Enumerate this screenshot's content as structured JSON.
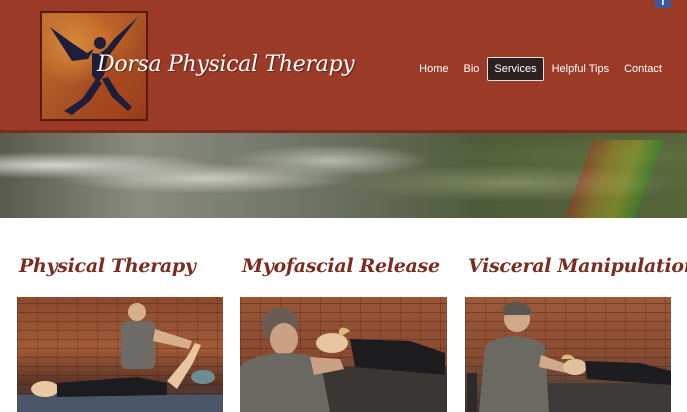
{
  "header": {
    "site_title": "Dorsa Physical Therapy",
    "facebook_icon": "facebook-icon",
    "logo": "dancing-figure-logo"
  },
  "nav": {
    "items": [
      {
        "label": "Home"
      },
      {
        "label": "Bio"
      },
      {
        "label": "Services",
        "active": true
      },
      {
        "label": "Helpful Tips"
      },
      {
        "label": "Contact"
      }
    ]
  },
  "services": [
    {
      "title": "Physical Therapy",
      "photo": "therapist-stretching-patient-leg"
    },
    {
      "title": "Myofascial Release",
      "photo": "therapist-treating-patient-neck"
    },
    {
      "title": "Visceral Manipulation",
      "photo": "therapist-treating-patient-head"
    }
  ],
  "colors": {
    "header_bg": "#9b3a27",
    "title_color": "#7b2b1f",
    "active_nav_bg": "#2c2121"
  }
}
